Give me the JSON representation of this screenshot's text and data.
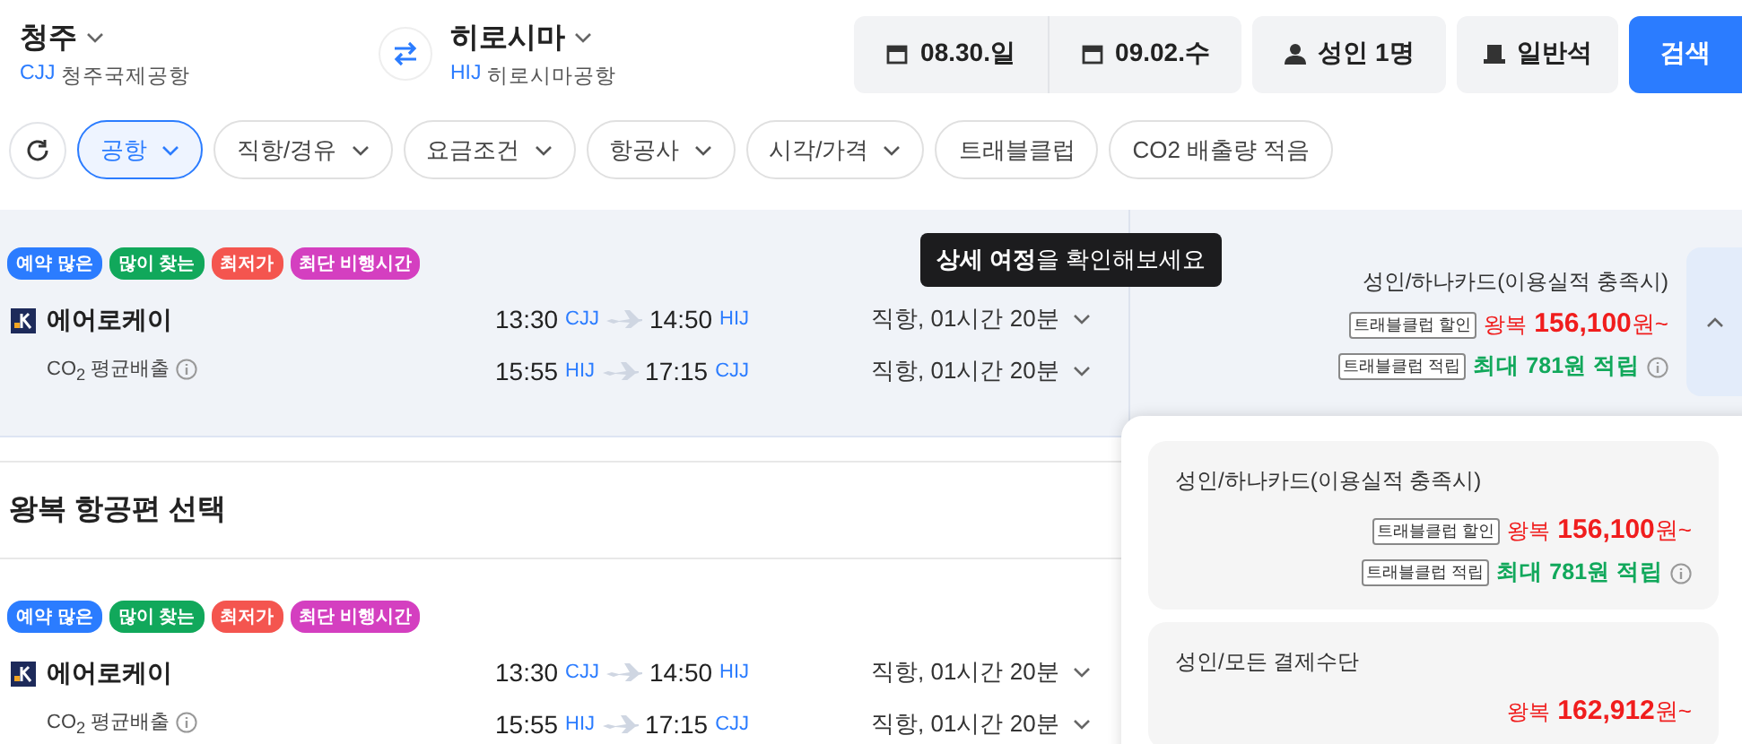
{
  "search": {
    "origin": {
      "city": "청주",
      "code": "CJJ",
      "airport": "청주국제공항"
    },
    "destination": {
      "city": "히로시마",
      "code": "HIJ",
      "airport": "히로시마공항"
    },
    "dates": [
      "08.30.일",
      "09.02.수"
    ],
    "passengers": "성인 1명",
    "cabin": "일반석",
    "search_button": "검색"
  },
  "filters": [
    {
      "label": "공항",
      "selected": true,
      "dropdown": true
    },
    {
      "label": "직항/경유",
      "selected": false,
      "dropdown": true
    },
    {
      "label": "요금조건",
      "selected": false,
      "dropdown": true
    },
    {
      "label": "항공사",
      "selected": false,
      "dropdown": true
    },
    {
      "label": "시각/가격",
      "selected": false,
      "dropdown": true
    },
    {
      "label": "트래블클럽",
      "selected": false,
      "dropdown": false
    },
    {
      "label": "CO2 배출량 적음",
      "selected": false,
      "dropdown": false
    }
  ],
  "tooltip": "**상세 여정**을 확인해보세요",
  "results": [
    {
      "selected": true,
      "expanded": true,
      "badges": [
        {
          "label": "예약 많은",
          "color": "#2b7cff"
        },
        {
          "label": "많이 찾는",
          "color": "#11a85b"
        },
        {
          "label": "최저가",
          "color": "#f4554f"
        },
        {
          "label": "최단 비행시간",
          "color": "#d43fc0"
        }
      ],
      "airline": "에어로케이",
      "co2": "CO$_{2}$ 평균배출",
      "legs": [
        {
          "dep_time": "13:30",
          "dep_code": "CJJ",
          "arr_time": "14:50",
          "arr_code": "HIJ",
          "info": "직항, 01시간 20분"
        },
        {
          "dep_time": "15:55",
          "dep_code": "HIJ",
          "arr_time": "17:15",
          "arr_code": "CJJ",
          "info": "직항, 01시간 20분"
        }
      ],
      "fare": {
        "title": "성인/하나카드(이용실적 충족시)",
        "discount_tag": "트래블클럽 할인",
        "prefix": "왕복",
        "price": "**156,100**원~",
        "reward_tag": "트래블클럽 적립",
        "reward": "최대 781원 적립"
      }
    }
  ],
  "section_title": "왕복 항공편 선택",
  "results_2": [
    {
      "selected": false,
      "badges": [
        {
          "label": "예약 많은",
          "color": "#2b7cff"
        },
        {
          "label": "많이 찾는",
          "color": "#11a85b"
        },
        {
          "label": "최저가",
          "color": "#f4554f"
        },
        {
          "label": "최단 비행시간",
          "color": "#d43fc0"
        }
      ],
      "airline": "에어로케이",
      "co2": "CO$_{2}$ 평균배출",
      "legs": [
        {
          "dep_time": "13:30",
          "dep_code": "CJJ",
          "arr_time": "14:50",
          "arr_code": "HIJ",
          "info": "직항, 01시간 20분"
        },
        {
          "dep_time": "15:55",
          "dep_code": "HIJ",
          "arr_time": "17:15",
          "arr_code": "CJJ",
          "info": "직항, 01시간 20분"
        }
      ]
    }
  ],
  "fare_popup": [
    {
      "title": "성인/하나카드(이용실적 충족시)",
      "discount_tag": "트래블클럽 할인",
      "prefix": "왕복",
      "price": "**156,100**원~",
      "reward_tag": "트래블클럽 적립",
      "reward": "최대 781원 적립"
    },
    {
      "title": "성인/모든 결제수단",
      "prefix": "왕복",
      "price": "**162,912**원~"
    }
  ]
}
